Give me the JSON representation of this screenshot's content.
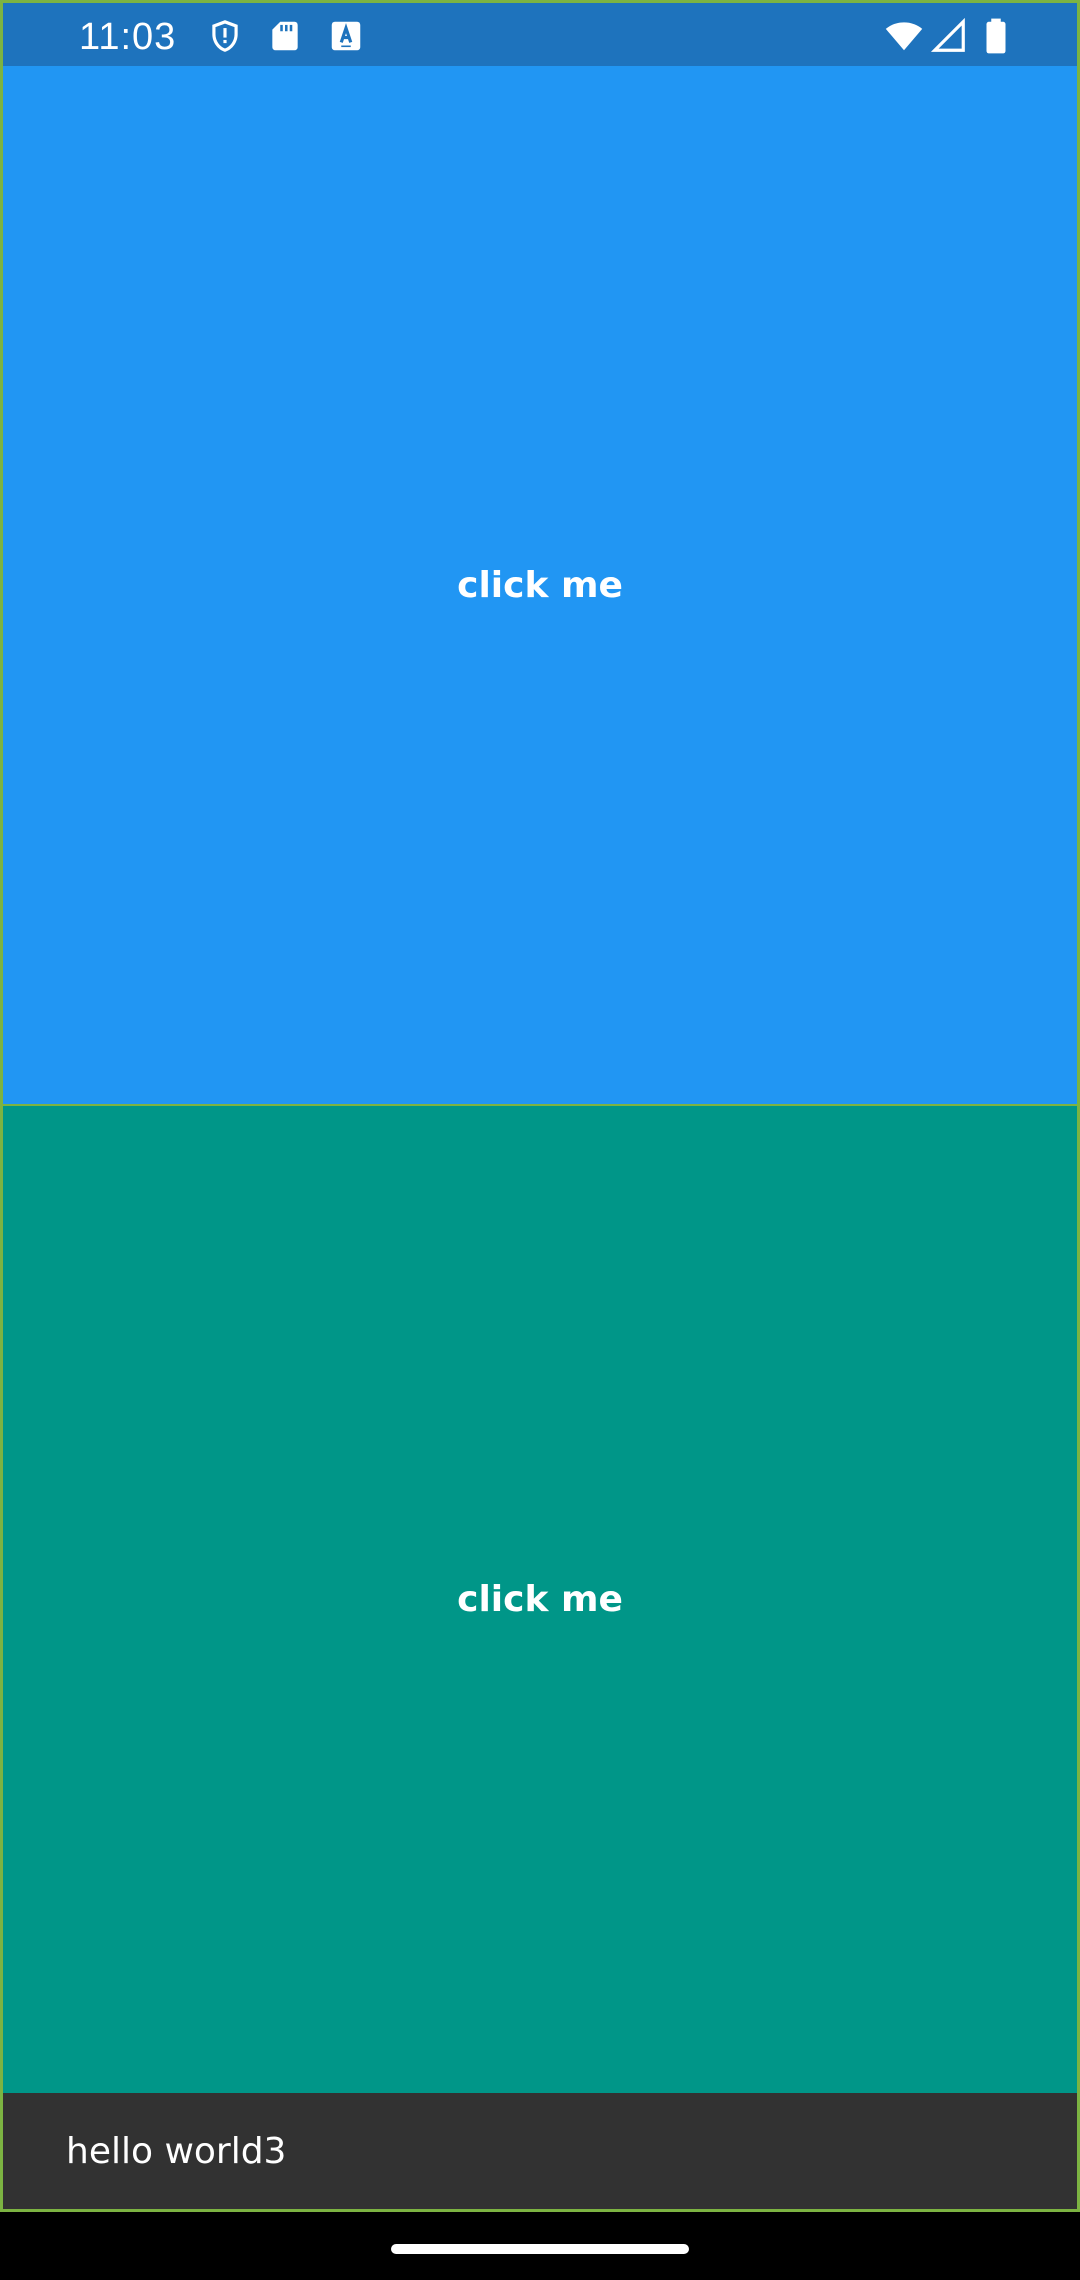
{
  "status_bar": {
    "time": "11:03",
    "background": "#1E73BD",
    "left_icons": [
      "shield-alert-icon",
      "sd-card-icon",
      "keyboard-a-icon"
    ],
    "right_icons": [
      "wifi-icon",
      "cell-signal-icon",
      "battery-icon"
    ]
  },
  "main": {
    "top_panel": {
      "label": "click me",
      "color": "#2196F3"
    },
    "bottom_panel": {
      "label": "click me",
      "color": "#009688"
    }
  },
  "snackbar": {
    "message": "hello world3",
    "background": "#323232"
  },
  "navigation": {
    "home_indicator": "home-pill"
  }
}
